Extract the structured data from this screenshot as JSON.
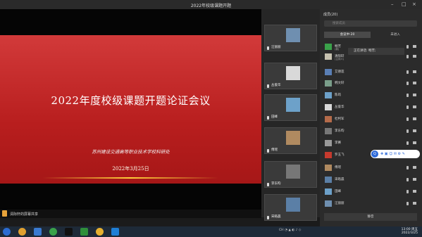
{
  "window": {
    "title": "2022年校级课题开题"
  },
  "slide": {
    "title": "2022年度校级课题开题论证会议",
    "org": "苏州建设交通高等职业技术学校科研处",
    "date": "2022年3月25日"
  },
  "share_bar": {
    "label": "清际轩的屏幕共享"
  },
  "videos": [
    {
      "name": "汪丽丽"
    },
    {
      "name": "丛俊华"
    },
    {
      "name": "田峰"
    },
    {
      "name": "傅瑶"
    },
    {
      "name": "李东昀"
    },
    {
      "name": "宋皓晨"
    }
  ],
  "panel": {
    "header": "成员(20)",
    "search_placeholder": "搜索成员",
    "tabs": [
      "会议中·20",
      "未进入"
    ],
    "speaking": "正在讲话: 畅芳;",
    "mute_all": "静音",
    "members": [
      {
        "name": "畅芳",
        "sub": "(我)"
      },
      {
        "name": "清际轩",
        "sub": "(主持人)"
      },
      {
        "name": "艾德莲",
        "sub": ""
      },
      {
        "name": "韩文轩",
        "sub": ""
      },
      {
        "name": "陈筠",
        "sub": ""
      },
      {
        "name": "丛俊华",
        "sub": ""
      },
      {
        "name": "杜柯军",
        "sub": ""
      },
      {
        "name": "李东昀",
        "sub": ""
      },
      {
        "name": "李赛",
        "sub": ""
      },
      {
        "name": "罗玉飞",
        "sub": ""
      },
      {
        "name": "傅瑶",
        "sub": ""
      },
      {
        "name": "宋皓晨",
        "sub": ""
      },
      {
        "name": "田峰",
        "sub": ""
      },
      {
        "name": "汪丽丽",
        "sub": ""
      }
    ]
  },
  "taskbar": {
    "tray_lang": "CH",
    "time": "13:00 周五",
    "date": "2022/3/25"
  },
  "colors": {
    "slide_red": "#c62828",
    "accent_blue": "#2b68d8"
  }
}
